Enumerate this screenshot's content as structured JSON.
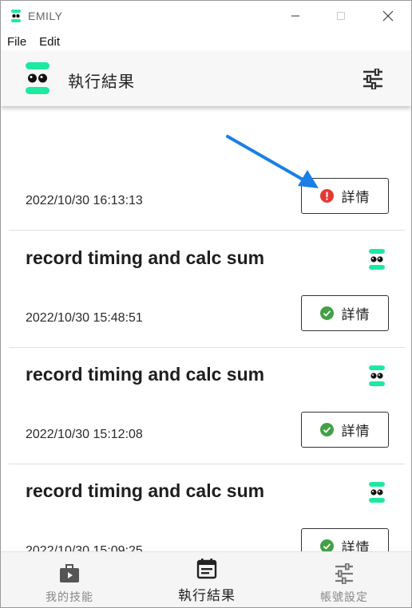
{
  "window": {
    "title": "EMILY"
  },
  "menu": [
    "File",
    "Edit"
  ],
  "header": {
    "title": "執行結果",
    "settings_icon": "tune-icon"
  },
  "results": [
    {
      "name": "",
      "timestamp": "2022/10/30 16:13:13",
      "status": "error",
      "detail_label": "詳情"
    },
    {
      "name": "record timing and calc sum",
      "timestamp": "2022/10/30 15:48:51",
      "status": "success",
      "detail_label": "詳情"
    },
    {
      "name": "record timing and calc sum",
      "timestamp": "2022/10/30 15:12:08",
      "status": "success",
      "detail_label": "詳情"
    },
    {
      "name": "record timing and calc sum",
      "timestamp": "2022/10/30 15:09:25",
      "status": "success",
      "detail_label": "詳情"
    }
  ],
  "nav": [
    {
      "label": "我的技能",
      "icon": "briefcase-icon",
      "active": false
    },
    {
      "label": "執行結果",
      "icon": "calendar-icon",
      "active": true
    },
    {
      "label": "帳號設定",
      "icon": "tune-icon",
      "active": false
    }
  ],
  "colors": {
    "brand": "#1de9a0",
    "error": "#e53935",
    "success": "#43a047",
    "annotation": "#1a7fe6"
  }
}
